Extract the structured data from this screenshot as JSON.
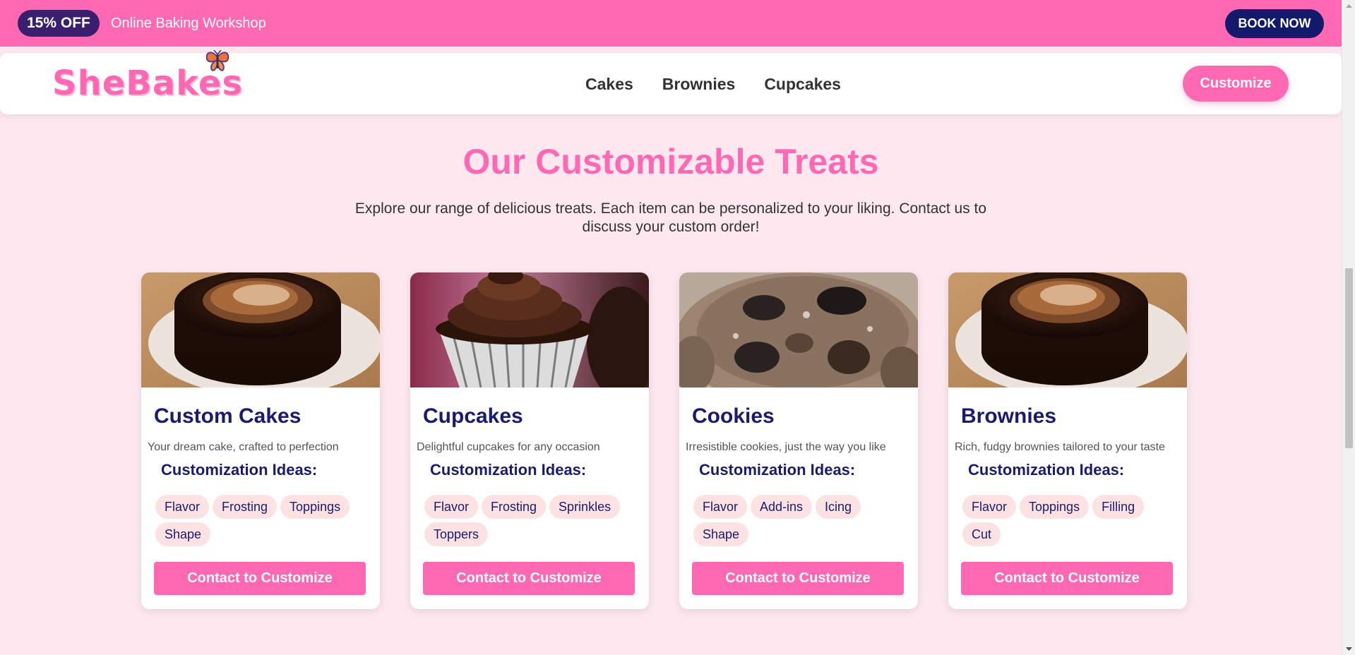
{
  "promo": {
    "badge": "15% OFF",
    "text": "Online Baking Workshop",
    "button": "BOOK NOW"
  },
  "navbar": {
    "logo": "SheBakes",
    "links": [
      "Cakes",
      "Brownies",
      "Cupcakes"
    ],
    "customize": "Customize"
  },
  "section": {
    "title": "Our Customizable Treats",
    "description": "Explore our range of delicious treats. Each item can be personalized to your liking. Contact us to discuss your custom order!"
  },
  "cards": [
    {
      "title": "Custom Cakes",
      "description": "Your dream cake, crafted to perfection",
      "ideas_heading": "Customization Ideas:",
      "tags": [
        "Flavor",
        "Frosting",
        "Toppings",
        "Shape"
      ],
      "button": "Contact to Customize",
      "image": "chocolate-cake-image"
    },
    {
      "title": "Cupcakes",
      "description": "Delightful cupcakes for any occasion",
      "ideas_heading": "Customization Ideas:",
      "tags": [
        "Flavor",
        "Frosting",
        "Sprinkles",
        "Toppers"
      ],
      "button": "Contact to Customize",
      "image": "chocolate-cupcake-image"
    },
    {
      "title": "Cookies",
      "description": "Irresistible cookies, just the way you like",
      "ideas_heading": "Customization Ideas:",
      "tags": [
        "Flavor",
        "Add-ins",
        "Icing",
        "Shape"
      ],
      "button": "Contact to Customize",
      "image": "cookie-image"
    },
    {
      "title": "Brownies",
      "description": "Rich, fudgy brownies tailored to your taste",
      "ideas_heading": "Customization Ideas:",
      "tags": [
        "Flavor",
        "Toppings",
        "Filling",
        "Cut"
      ],
      "button": "Contact to Customize",
      "image": "chocolate-cake-image"
    }
  ],
  "colors": {
    "pink": "#ff69b4",
    "navy": "#1a1a6e",
    "background": "#fde8ef",
    "tag_bg": "#fde2e4"
  }
}
